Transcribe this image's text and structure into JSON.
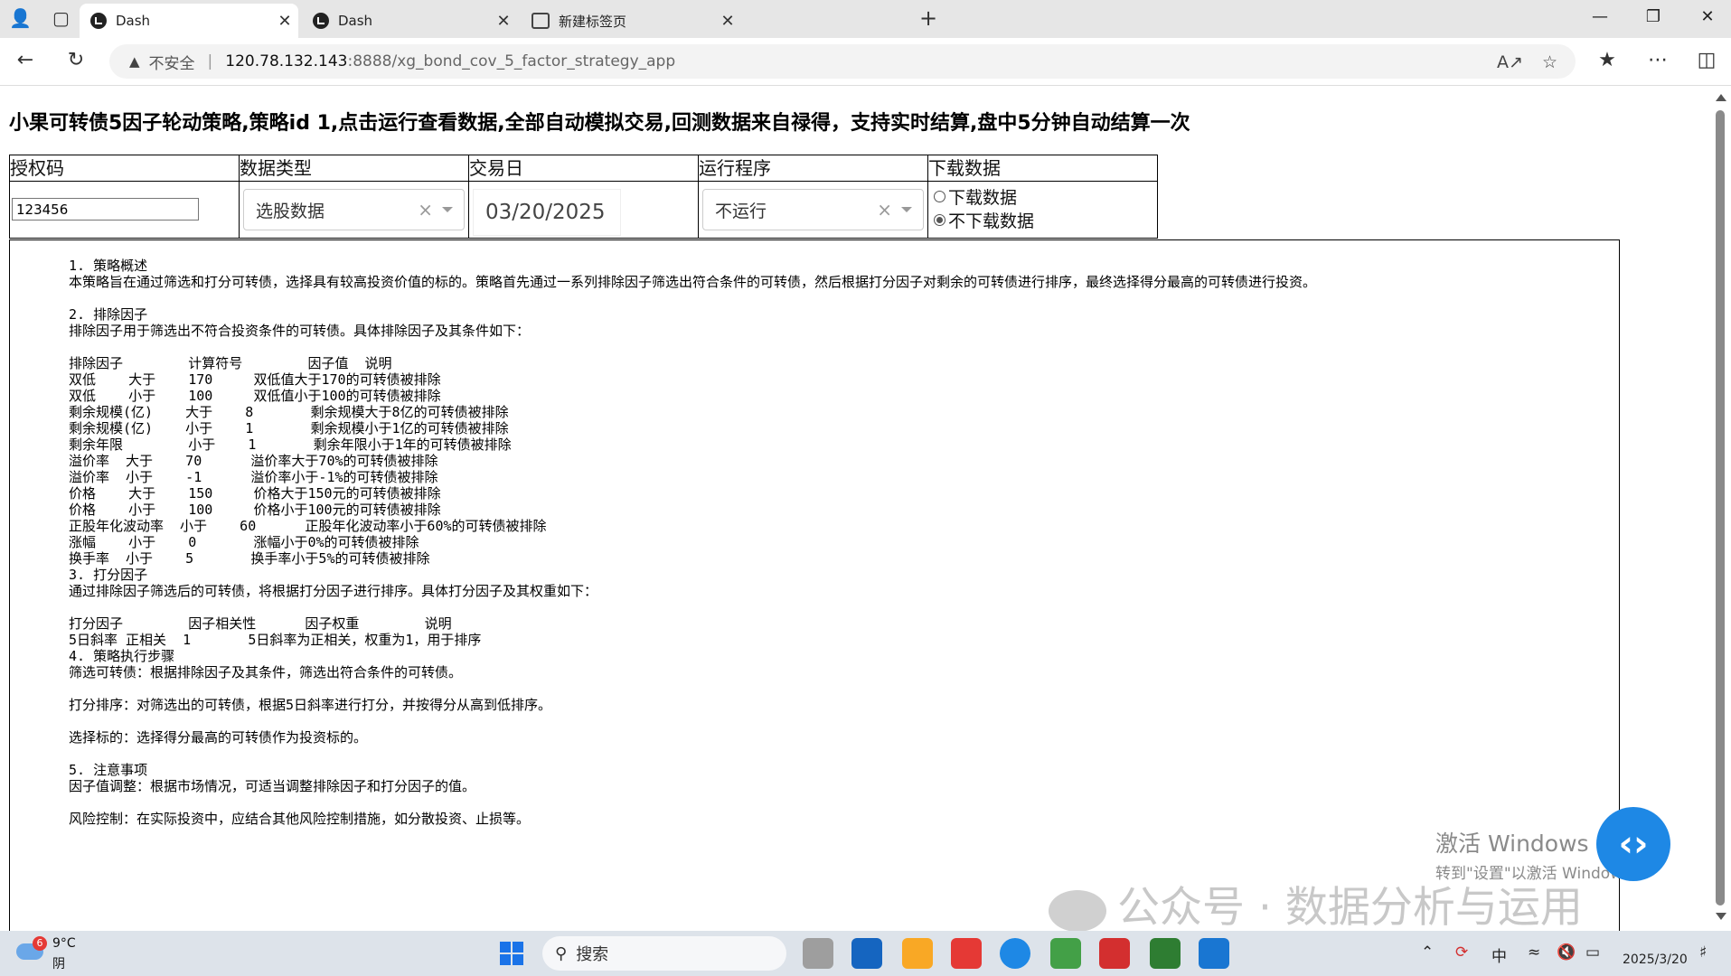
{
  "browser": {
    "tabs": [
      {
        "title": "Dash",
        "active": true
      },
      {
        "title": "Dash",
        "active": false
      },
      {
        "title": "新建标签页",
        "active": false
      }
    ],
    "address": {
      "security_label": "不安全",
      "host": "120.78.132.143",
      "rest": ":8888/xg_bond_cov_5_factor_strategy_app"
    }
  },
  "page": {
    "title": "小果可转债5因子轮动策略,策略id 1,点击运行查看数据,全部自动模拟交易,回测数据来自禄得，支持实时结算,盘中5分钟自动结算一次",
    "controls": {
      "headers": [
        "授权码",
        "数据类型",
        "交易日",
        "运行程序",
        "下载数据"
      ],
      "auth_code": "123456",
      "data_type": "选股数据",
      "trade_date": "03/20/2025",
      "run_program": "不运行",
      "download_options": [
        "下载数据",
        "不下载数据"
      ],
      "download_selected": "不下载数据"
    },
    "description": "1. 策略概述\n本策略旨在通过筛选和打分可转债，选择具有较高投资价值的标的。策略首先通过一系列排除因子筛选出符合条件的可转债，然后根据打分因子对剩余的可转债进行排序，最终选择得分最高的可转债进行投资。\n\n2. 排除因子\n排除因子用于筛选出不符合投资条件的可转债。具体排除因子及其条件如下：\n\n排除因子        计算符号        因子值  说明\n双低    大于    170     双低值大于170的可转债被排除\n双低    小于    100     双低值小于100的可转债被排除\n剩余规模(亿)    大于    8       剩余规模大于8亿的可转债被排除\n剩余规模(亿)    小于    1       剩余规模小于1亿的可转债被排除\n剩余年限        小于    1       剩余年限小于1年的可转债被排除\n溢价率  大于    70      溢价率大于70%的可转债被排除\n溢价率  小于    -1      溢价率小于-1%的可转债被排除\n价格    大于    150     价格大于150元的可转债被排除\n价格    小于    100     价格小于100元的可转债被排除\n正股年化波动率  小于    60      正股年化波动率小于60%的可转债被排除\n涨幅    小于    0       涨幅小于0%的可转债被排除\n换手率  小于    5       换手率小于5%的可转债被排除\n3. 打分因子\n通过排除因子筛选后的可转债，将根据打分因子进行排序。具体打分因子及其权重如下：\n\n打分因子        因子相关性      因子权重        说明\n5日斜率 正相关  1       5日斜率为正相关，权重为1，用于排序\n4. 策略执行步骤\n筛选可转债：根据排除因子及其条件，筛选出符合条件的可转债。\n\n打分排序：对筛选出的可转债，根据5日斜率进行打分，并按得分从高到低排序。\n\n选择标的：选择得分最高的可转债作为投资标的。\n\n5. 注意事项\n因子值调整：根据市场情况，可适当调整排除因子和打分因子的值。\n\n风险控制：在实际投资中，应结合其他风险控制措施，如分散投资、止损等。"
  },
  "overlay": {
    "activation_line1": "激活 Windows",
    "activation_line2": "转到\"设置\"以激活 Windows。",
    "watermark": "公众号 · 数据分析与运用"
  },
  "taskbar": {
    "weather_badge": "6",
    "temperature": "9°C",
    "condition": "阴",
    "search_placeholder": "搜索",
    "ime": "中",
    "date": "2025/3/20"
  }
}
